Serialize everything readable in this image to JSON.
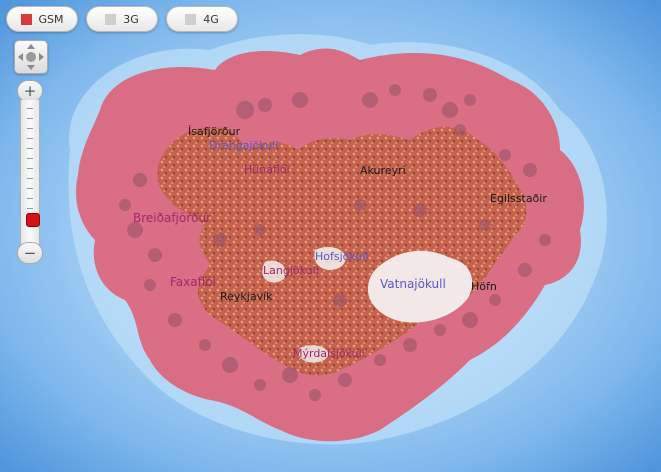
{
  "tabs": [
    {
      "label": "GSM",
      "swatch": "#d63a3a",
      "active": true
    },
    {
      "label": "3G",
      "swatch": "#cfcfcf",
      "active": false
    },
    {
      "label": "4G",
      "swatch": "#cfcfcf",
      "active": false
    }
  ],
  "zoom": {
    "plus": "+",
    "minus": "−",
    "level_fraction": 0.1
  },
  "map": {
    "sea_color": "#6aa9e4",
    "coverage_color": "#e0566a",
    "land_color": "#c9694c",
    "glacier_color": "#f4f4f4",
    "places": {
      "isafjordur": "Ísafjörður",
      "drangajokull": "Drangajökull",
      "hunafloi": "Húnaflói",
      "akureyri": "Akureyri",
      "egilsstadir": "Egilsstaðir",
      "breidafjordur": "Breiðafjörður",
      "hofsjokull": "Hofsjökull",
      "langjokull": "Langjökull",
      "vatnajokull": "Vatnajökull",
      "hofn": "Höfn",
      "faxafloi": "Faxaflói",
      "reykjavik": "Reykjavík",
      "myrdalsjokull": "Mýrdalsjökull"
    }
  }
}
